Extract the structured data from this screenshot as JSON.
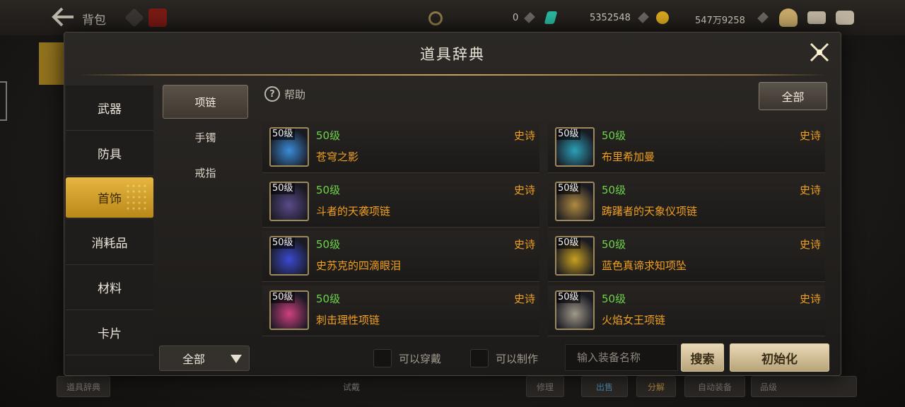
{
  "topbar": {
    "title": "背包",
    "res_zero": "0",
    "res_a": "5352548",
    "res_b": "547万9258"
  },
  "background": {
    "bottom_left_label": "道具辞典",
    "bottom_mid_label": "试戴",
    "btn_repair": "修理",
    "btn_sell": "出售",
    "btn_decompose": "分解",
    "btn_auto": "自动装备",
    "sort_label": "品级"
  },
  "modal": {
    "title": "道具辞典",
    "categories": [
      {
        "label": "武器"
      },
      {
        "label": "防具"
      },
      {
        "label": "首饰"
      },
      {
        "label": "消耗品"
      },
      {
        "label": "材料"
      },
      {
        "label": "卡片"
      }
    ],
    "active_category": 2,
    "subtabs": [
      {
        "label": "项链"
      },
      {
        "label": "手镯"
      },
      {
        "label": "戒指"
      }
    ],
    "active_subtab": 0,
    "help_label": "帮助",
    "filter_all_label": "全部",
    "items": [
      {
        "tag": "50级",
        "level": "50级",
        "rarity": "史诗",
        "name": "苍穹之影",
        "icon": "blue-orb-necklace-icon",
        "color": "#3a8cd8"
      },
      {
        "tag": "50级",
        "level": "50级",
        "rarity": "史诗",
        "name": "布里希加曼",
        "icon": "teal-gold-arc-icon",
        "color": "#2aa0b8"
      },
      {
        "tag": "50级",
        "level": "50级",
        "rarity": "史诗",
        "name": "斗者的天袭项链",
        "icon": "dark-mask-icon",
        "color": "#5a4a8a"
      },
      {
        "tag": "50级",
        "level": "50级",
        "rarity": "史诗",
        "name": "踌躇者的天象仪项链",
        "icon": "golden-astrolabe-icon",
        "color": "#b08a40"
      },
      {
        "tag": "50级",
        "level": "50级",
        "rarity": "史诗",
        "name": "史苏克的四滴眼泪",
        "icon": "blue-gem-cluster-icon",
        "color": "#3a4ad0"
      },
      {
        "tag": "50级",
        "level": "50级",
        "rarity": "史诗",
        "name": "蓝色真谛求知项坠",
        "icon": "gold-scroll-pendant-icon",
        "color": "#c8a020"
      },
      {
        "tag": "50级",
        "level": "50级",
        "rarity": "史诗",
        "name": "刺击理性项链",
        "icon": "pink-ring-necklace-icon",
        "color": "#d04080"
      },
      {
        "tag": "50级",
        "level": "50级",
        "rarity": "史诗",
        "name": "火焰女王项链",
        "icon": "silver-blade-pendant-icon",
        "color": "#a09888"
      }
    ],
    "bottom": {
      "dropdown_value": "全部",
      "check_wearable": "可以穿戴",
      "check_craftable": "可以制作",
      "search_placeholder": "输入装备名称",
      "search_button": "搜索",
      "reset_button": "初始化"
    }
  },
  "colors": {
    "level_green": "#6ed44a",
    "rarity_orange": "#f0a020",
    "active_gold": "#d9a72c"
  }
}
